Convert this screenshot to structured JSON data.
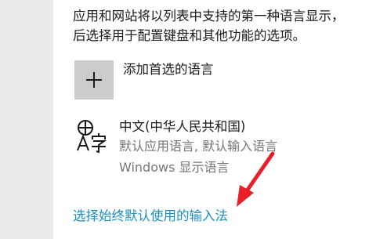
{
  "description": {
    "line1": "应用和网站将以列表中支持的第一种语言显示，",
    "line2": "后选择用于配置键盘和其他功能的选项。"
  },
  "add_language": {
    "label": "添加首选的语言",
    "icon": "plus-icon"
  },
  "language": {
    "icon": "language-glyph-icon",
    "name": "中文(中华人民共和国)",
    "sub1": "默认应用语言, 默认输入语言",
    "sub2": "Windows 显示语言"
  },
  "link": {
    "label": "选择始终默认使用的输入法"
  },
  "annotation": {
    "color": "#e8202a"
  }
}
